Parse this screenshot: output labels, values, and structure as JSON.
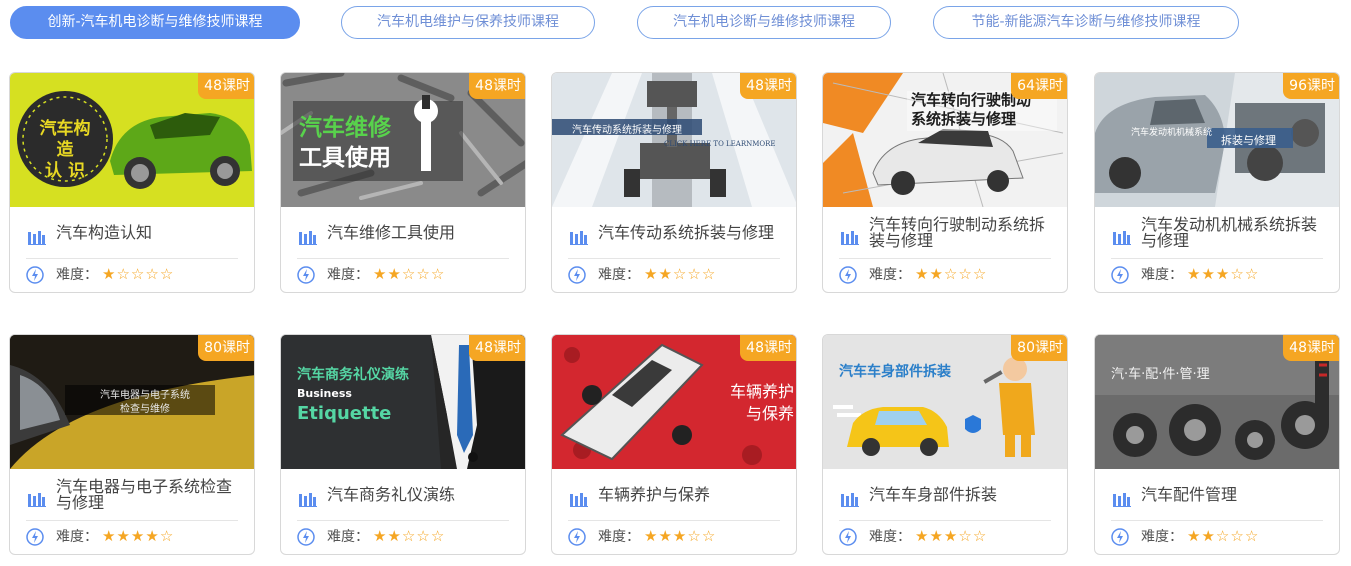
{
  "tabs": [
    {
      "label": "创新-汽车机电诊断与维修技师课程",
      "active": true
    },
    {
      "label": "汽车机电维护与保养技师课程",
      "active": false
    },
    {
      "label": "汽车机电诊断与维修技师课程",
      "active": false
    },
    {
      "label": "节能-新能源汽车诊断与维修技师课程",
      "active": false
    }
  ],
  "difficulty_label": "难度：",
  "colors": {
    "accent": "#5b8def",
    "badge": "#f5a623",
    "star": "#f5a623"
  },
  "courses": [
    {
      "title": "汽车构造认知",
      "hours": "48课时",
      "stars": 1,
      "thumb": {
        "line1": "汽车构造",
        "line2": "认 识"
      }
    },
    {
      "title": "汽车维修工具使用",
      "hours": "48课时",
      "stars": 2,
      "thumb": {
        "line1": "汽车维修",
        "line2": "工具使用"
      }
    },
    {
      "title": "汽车传动系统拆装与修理",
      "hours": "48课时",
      "stars": 2,
      "thumb": {
        "line1": "汽车传动系统拆装与修理",
        "line2": "CLICK HERE TO LEARNMORE"
      }
    },
    {
      "title": "汽车转向行驶制动系统拆装与修理",
      "hours": "64课时",
      "stars": 2,
      "thumb": {
        "line1": "汽车转向行驶制动",
        "line2": "系统拆装与修理"
      }
    },
    {
      "title": "汽车发动机机械系统拆装与修理",
      "hours": "96课时",
      "stars": 3,
      "thumb": {
        "line1": "汽车发动机机械系统",
        "line2": "拆装与修理"
      }
    },
    {
      "title": "汽车电器与电子系统检查与修理",
      "hours": "80课时",
      "stars": 4,
      "thumb": {
        "line1": "汽车电器与电子系统",
        "line2": "检查与维修"
      }
    },
    {
      "title": "汽车商务礼仪演练",
      "hours": "48课时",
      "stars": 2,
      "thumb": {
        "line1": "汽车商务礼仪演练",
        "line2": "Business",
        "line3": "Etiquette"
      }
    },
    {
      "title": "车辆养护与保养",
      "hours": "48课时",
      "stars": 3,
      "thumb": {
        "line1": "车辆养护",
        "line2": "与保养"
      }
    },
    {
      "title": "汽车车身部件拆装",
      "hours": "80课时",
      "stars": 3,
      "thumb": {
        "line1": "汽车车身部件拆装"
      }
    },
    {
      "title": "汽车配件管理",
      "hours": "48课时",
      "stars": 2,
      "thumb": {
        "line1": "汽·车·配·件·管·理"
      }
    }
  ]
}
